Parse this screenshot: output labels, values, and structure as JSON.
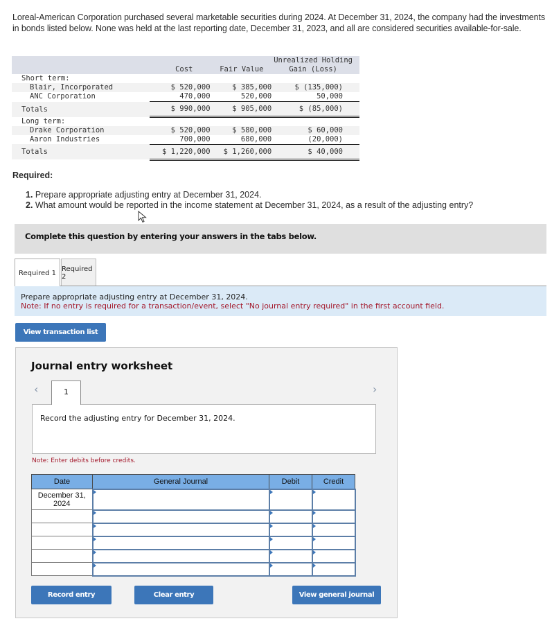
{
  "intro": "Loreal-American Corporation purchased several marketable securities during 2024. At December 31, 2024, the company had the investments in bonds listed below. None was held at the last reporting date, December 31, 2023, and all are considered securities available-for-sale.",
  "securities_table": {
    "headers": {
      "cost": "Cost",
      "fair_value": "Fair Value",
      "gain_line1": "Unrealized Holding",
      "gain_line2": "Gain (Loss)"
    },
    "short_term": {
      "label": "Short term:",
      "rows": [
        {
          "name": "Blair, Incorporated",
          "cost": "$ 520,000",
          "fair_value": "$ 385,000",
          "gain": "$ (135,000)"
        },
        {
          "name": "ANC Corporation",
          "cost": "470,000",
          "fair_value": "520,000",
          "gain": "50,000"
        }
      ],
      "totals": {
        "label": "Totals",
        "cost": "$ 990,000",
        "fair_value": "$ 905,000",
        "gain": "$ (85,000)"
      }
    },
    "long_term": {
      "label": "Long term:",
      "rows": [
        {
          "name": "Drake Corporation",
          "cost": "$ 520,000",
          "fair_value": "$ 580,000",
          "gain": "$ 60,000"
        },
        {
          "name": "Aaron Industries",
          "cost": "700,000",
          "fair_value": "680,000",
          "gain": "(20,000)"
        }
      ],
      "totals": {
        "label": "Totals",
        "cost": "$ 1,220,000",
        "fair_value": "$ 1,260,000",
        "gain": "$ 40,000"
      }
    }
  },
  "required": {
    "title": "Required:",
    "items": [
      {
        "num": "1.",
        "text": "Prepare appropriate adjusting entry at December 31, 2024."
      },
      {
        "num": "2.",
        "text": "What amount would be reported in the income statement at December 31, 2024, as a result of the adjusting entry?"
      }
    ]
  },
  "instruction_band": "Complete this question by entering your answers in the tabs below.",
  "tabs": [
    {
      "label": "Required 1",
      "active": true
    },
    {
      "label": "Required 2",
      "active": false
    }
  ],
  "info": {
    "prompt": "Prepare appropriate adjusting entry at December 31, 2024.",
    "note": "Note: If no entry is required for a transaction/event, select \"No journal entry required\" in the first account field."
  },
  "buttons": {
    "view_transaction_list": "View transaction list",
    "record_entry": "Record entry",
    "clear_entry": "Clear entry",
    "view_general_journal": "View general journal"
  },
  "worksheet": {
    "title": "Journal entry worksheet",
    "prev_icon": "‹",
    "next_icon": "›",
    "step": "1",
    "entry_text": "Record the adjusting entry for December 31, 2024.",
    "debit_note": "Note: Enter debits before credits.",
    "columns": [
      "Date",
      "General Journal",
      "Debit",
      "Credit"
    ],
    "rows": [
      {
        "date": "December 31, 2024",
        "account": "",
        "debit": "",
        "credit": ""
      },
      {
        "date": "",
        "account": "",
        "debit": "",
        "credit": ""
      },
      {
        "date": "",
        "account": "",
        "debit": "",
        "credit": ""
      },
      {
        "date": "",
        "account": "",
        "debit": "",
        "credit": ""
      },
      {
        "date": "",
        "account": "",
        "debit": "",
        "credit": ""
      },
      {
        "date": "",
        "account": "",
        "debit": "",
        "credit": ""
      }
    ]
  },
  "colors": {
    "button_blue": "#3c76b9",
    "header_blue": "#79aee5",
    "note_red": "#a3172a",
    "info_band": "#dbeaf7"
  }
}
